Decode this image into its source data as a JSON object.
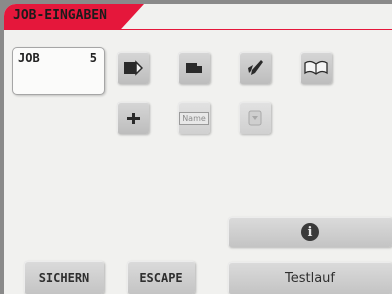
{
  "header": {
    "title": "JOB-EINGABEN"
  },
  "job": {
    "label": "JOB",
    "number": "5"
  },
  "icons": {
    "row1": [
      "fold-icon",
      "insert-icon",
      "seal-icon",
      "open-book-icon"
    ],
    "row2": [
      "plus-icon",
      "name-icon",
      "disabled-icon"
    ],
    "name_tag": "Name"
  },
  "buttons": {
    "save": "SICHERN",
    "escape": "ESCAPE",
    "info_symbol": "i",
    "test_run": "Testlauf"
  },
  "colors": {
    "accent": "#e5173b",
    "button": "#c9c9c9",
    "background": "#f1f1ef"
  }
}
